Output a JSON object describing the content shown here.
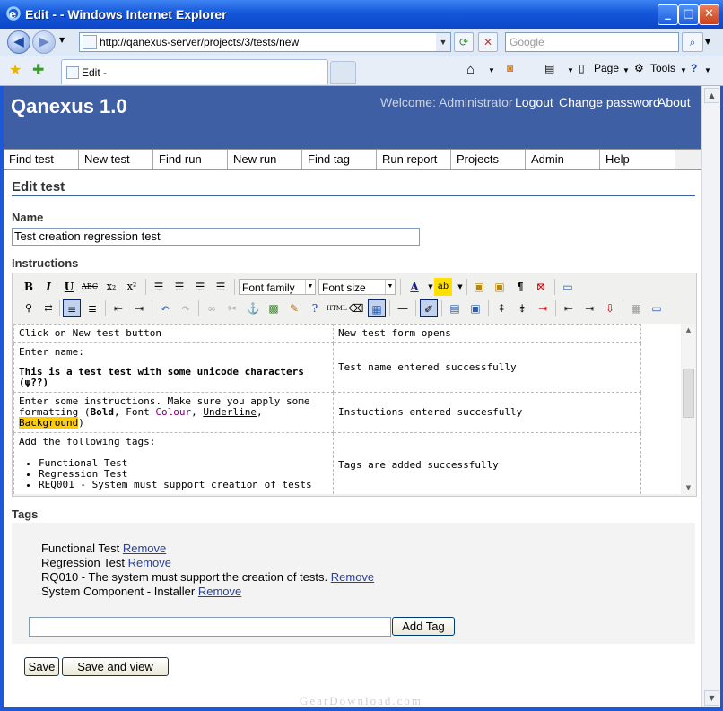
{
  "window": {
    "title": "Edit - - Windows Internet Explorer",
    "controls": {
      "minimize": "_",
      "maximize": "□",
      "close": "✕"
    }
  },
  "browser": {
    "back": "◀",
    "forward": "▶",
    "url": "http://qanexus-server/projects/3/tests/new",
    "search_placeholder": "Google",
    "tab_title": "Edit -",
    "page_menu": "Page",
    "tools_menu": "Tools"
  },
  "app": {
    "title": "Qanexus 1.0",
    "welcome": "Welcome: Administrator",
    "logout": "Logout",
    "change_password": "Change password",
    "about": "About",
    "menu": [
      "Find test",
      "New test",
      "Find run",
      "New run",
      "Find tag",
      "Run report",
      "Projects",
      "Admin",
      "Help"
    ]
  },
  "form": {
    "heading": "Edit test",
    "name_label": "Name",
    "name_value": "Test creation regression test",
    "instructions_label": "Instructions",
    "font_family": "Font family",
    "font_size": "Font size",
    "tags_label": "Tags"
  },
  "toolbar": {
    "bold": "B",
    "italic": "I",
    "underline": "U",
    "strike": "ABC",
    "subscript": "x₂",
    "superscript": "x²",
    "pilcrow": "¶"
  },
  "steps": [
    {
      "step": "Click on New test button",
      "result": "New test form opens"
    },
    {
      "step_line1": "Enter name:",
      "step_line2": "This is a test test with some unicode characters (ψ??)",
      "result": "Test name entered successfully"
    },
    {
      "step_pre": "Enter some instructions. Make sure you apply some formatting (",
      "bold": "Bold",
      "sep1": ", Font ",
      "colour": "Colour",
      "sep2": ", ",
      "underline": "Underline",
      "sep3": ", ",
      "background": "Background",
      "post": ")",
      "result": "Instuctions entered succesfully"
    },
    {
      "step_line1": "Add the following tags:",
      "items": [
        "Functional Test",
        "Regression Test",
        "REQ001 - System must support creation of tests"
      ],
      "result": "Tags are added successfully"
    }
  ],
  "tags": [
    {
      "name": "Functional Test",
      "action": "Remove"
    },
    {
      "name": "Regression Test",
      "action": "Remove"
    },
    {
      "name": "RQ010 - The system must support the creation of tests.",
      "action": "Remove"
    },
    {
      "name": "System Component - Installer",
      "action": "Remove"
    }
  ],
  "buttons": {
    "add_tag": "Add Tag",
    "save": "Save",
    "save_and_view": "Save and view"
  },
  "watermark": "GearDownload.com"
}
